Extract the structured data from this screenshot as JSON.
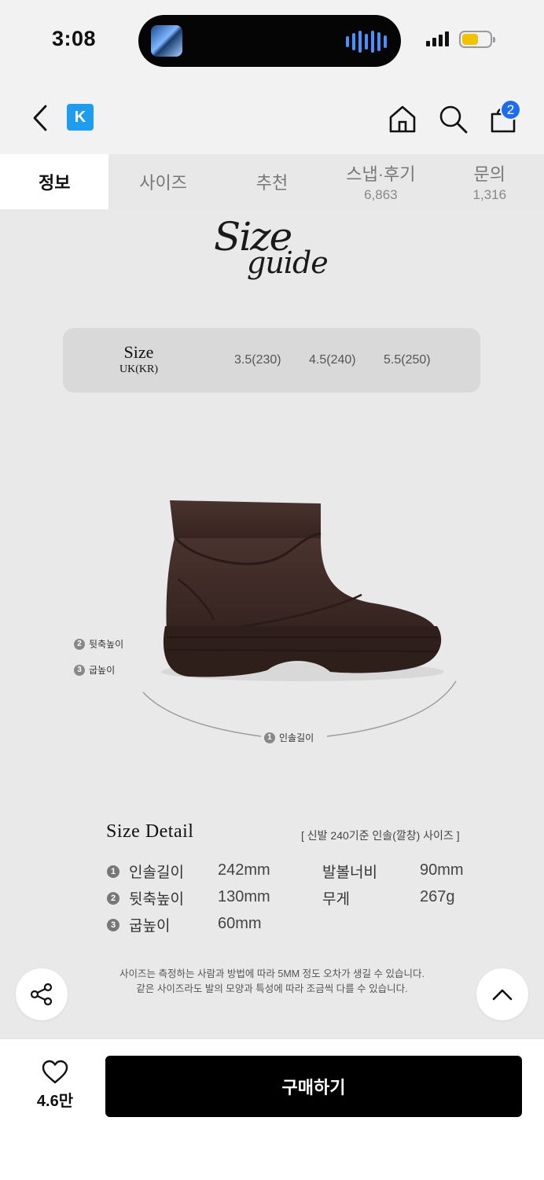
{
  "status_bar": {
    "time": "3:08",
    "battery_level": 0.6
  },
  "nav": {
    "brand_logo": "K",
    "cart_count": "2",
    "icons": [
      "back-icon",
      "home-icon",
      "search-icon",
      "cart-icon"
    ]
  },
  "tabs": [
    {
      "label": "정보",
      "count": "",
      "active": true
    },
    {
      "label": "사이즈",
      "count": ""
    },
    {
      "label": "추천",
      "count": ""
    },
    {
      "label": "스냅·후기",
      "count": "6,863"
    },
    {
      "label": "문의",
      "count": "1,316"
    }
  ],
  "size_guide": {
    "logo_line1": "Size",
    "logo_line2": "guide",
    "table_header": "Size",
    "table_subheader": "UK(KR)",
    "sizes": [
      "3.5(230)",
      "4.5(240)",
      "5.5(250)"
    ]
  },
  "diagram_labels": {
    "heel_height": "뒷축높이",
    "sole_height": "굽높이",
    "insole_length": "인솔길이"
  },
  "size_detail": {
    "title": "Size Detail",
    "note": "[ 신발 240기준 인솔(깔창) 사이즈 ]",
    "rows": [
      {
        "num": "1",
        "label": "인솔길이",
        "value": "242mm"
      },
      {
        "num": "2",
        "label": "뒷축높이",
        "value": "130mm"
      },
      {
        "num": "3",
        "label": "굽높이",
        "value": "60mm"
      }
    ],
    "extra": [
      {
        "label": "발볼너비",
        "value": "90mm"
      },
      {
        "label": "무게",
        "value": "267g"
      }
    ]
  },
  "disclaimer": {
    "line1": "사이즈는 측정하는 사람과 방법에 따라 5MM 정도 오차가 생길 수 있습니다.",
    "line2": "같은 사이즈라도 발의 모양과 특성에 따라 조금씩 다를 수 있습니다."
  },
  "bottom_bar": {
    "like_count": "4.6만",
    "buy_label": "구매하기"
  },
  "colors": {
    "accent_blue": "#1d6cf0",
    "brand_blue": "#1e9cf0",
    "shoe_brown": "#3f2b27",
    "buy_button": "#000000"
  }
}
